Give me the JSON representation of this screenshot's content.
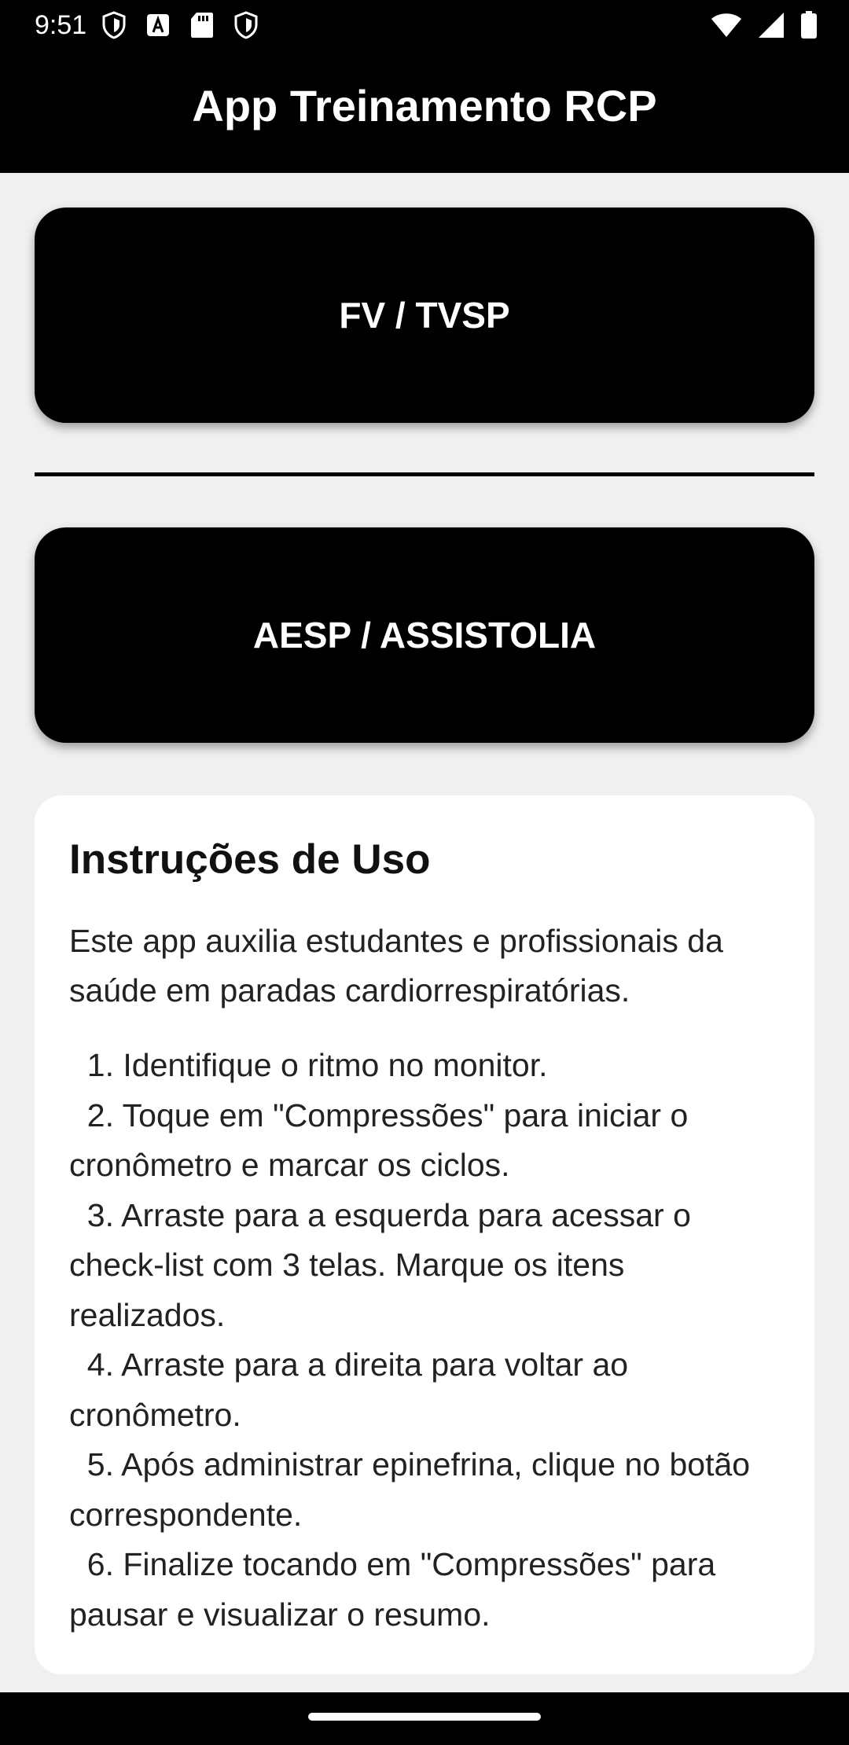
{
  "status_bar": {
    "time": "9:51",
    "left_icons": [
      "shield-icon",
      "a-box-icon",
      "sd-card-icon",
      "shield-icon"
    ],
    "right_icons": [
      "wifi-icon",
      "cell-signal-icon",
      "battery-icon"
    ]
  },
  "app_bar": {
    "title": "App Treinamento RCP"
  },
  "buttons": {
    "fv_label": "FV / TVSP",
    "aesp_label": "AESP / ASSISTOLIA"
  },
  "instructions": {
    "title": "Instruções de Uso",
    "intro": "Este app auxilia estudantes e profissionais da saúde em paradas cardiorrespiratórias.",
    "steps": [
      "  1. Identifique o ritmo no monitor.",
      "  2. Toque em \"Compressões\" para iniciar o cronômetro e marcar os ciclos.",
      "  3. Arraste para a esquerda para acessar o check-list com 3 telas. Marque os itens realizados.",
      "  4. Arraste para a direita para voltar ao cronômetro.",
      "  5. Após administrar epinefrina, clique no botão correspondente.",
      "  6. Finalize tocando em \"Compressões\" para pausar e visualizar o resumo."
    ]
  },
  "colors": {
    "app_bar": "#000000",
    "button": "#000000",
    "background": "#f0f0f0",
    "card": "#ffffff"
  }
}
